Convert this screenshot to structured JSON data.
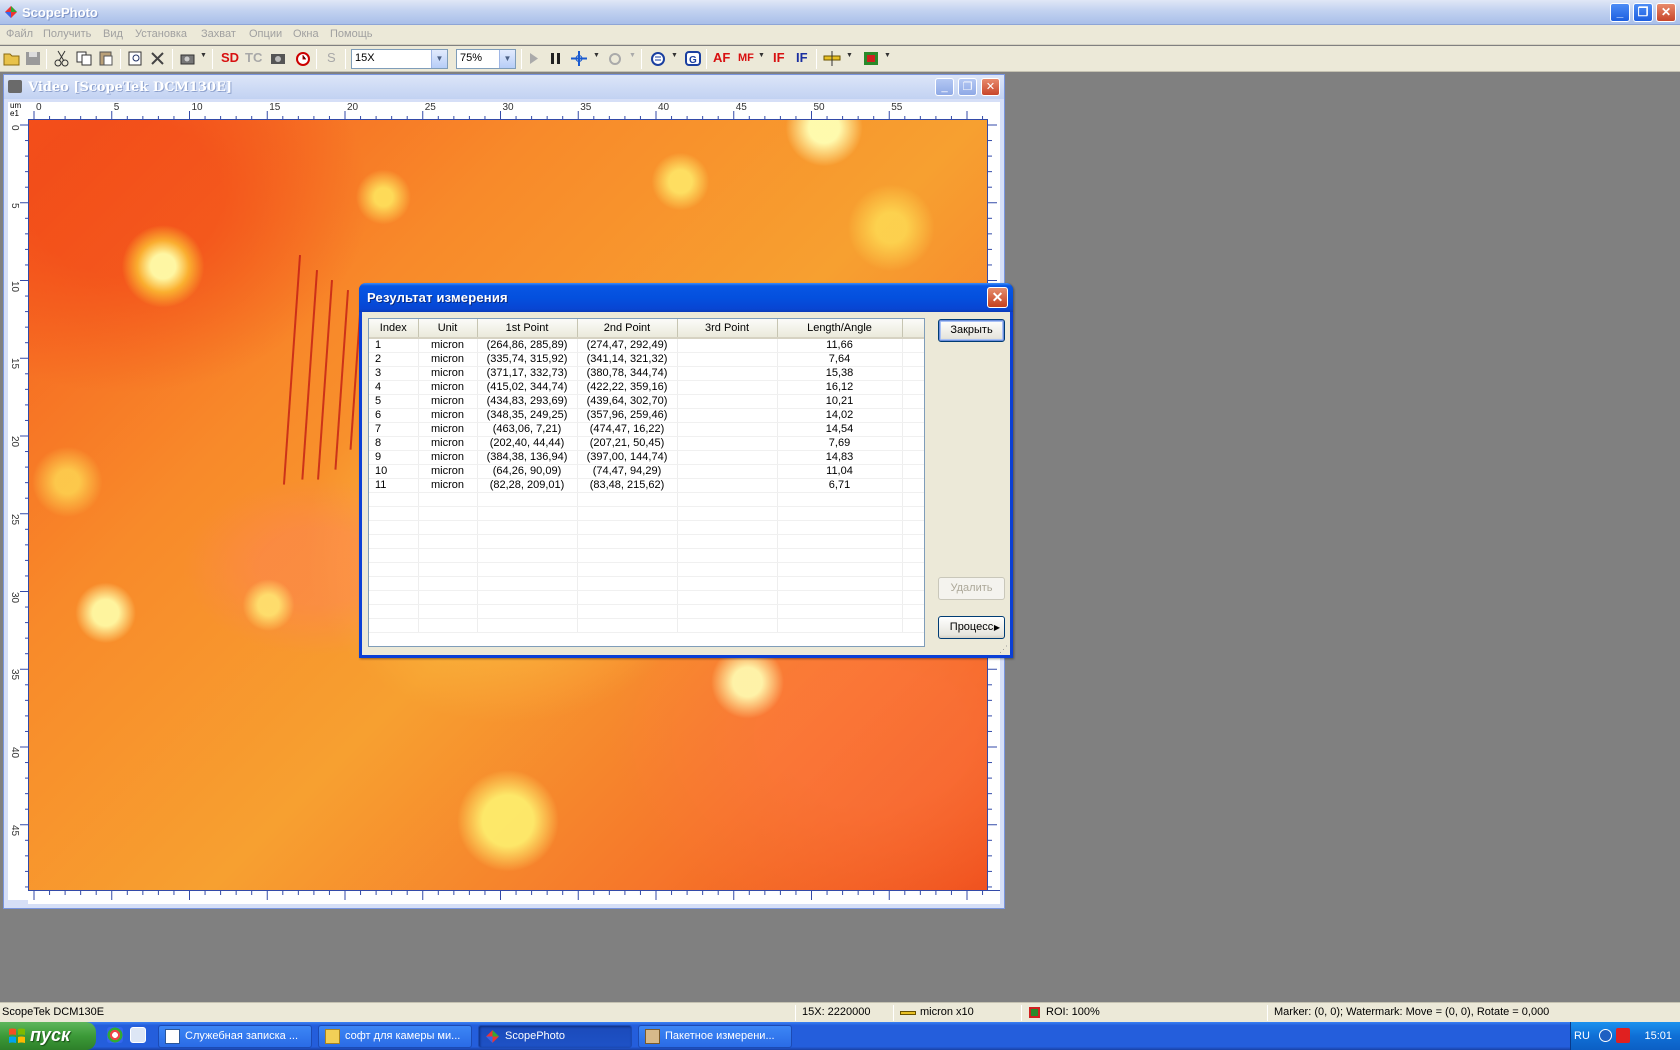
{
  "app": {
    "title": "ScopePhoto",
    "controls": {
      "minimize": "_",
      "restore": "❐",
      "close": "✕"
    }
  },
  "menu": [
    "Файл",
    "Получить",
    "Вид",
    "Установка",
    "Захват",
    "Опции",
    "Окна",
    "Помощь"
  ],
  "toolbar": {
    "sd_label": "SD",
    "tc_label": "TC",
    "s_label": "S",
    "zoom_combo": "15X",
    "scale_combo": "75%",
    "af_label": "AF",
    "mf_label": "MF",
    "if1_label": "IF",
    "if2_label": "IF"
  },
  "video_window": {
    "title": "Video [ScopeTek DCM130E]",
    "ruler_unit": "um e1",
    "ruler_top_labels": [
      "0",
      "5",
      "10",
      "15",
      "20",
      "25",
      "30",
      "35",
      "40",
      "45",
      "50",
      "55"
    ],
    "ruler_left_labels": [
      "0",
      "5",
      "10",
      "15",
      "20",
      "25",
      "30",
      "35",
      "40",
      "45"
    ]
  },
  "dialog": {
    "title": "Результат измерения",
    "columns": [
      "Index",
      "Unit",
      "1st Point",
      "2nd Point",
      "3rd Point",
      "Length/Angle"
    ],
    "rows": [
      [
        "1",
        "micron",
        "(264,86, 285,89)",
        "(274,47, 292,49)",
        "",
        "11,66"
      ],
      [
        "2",
        "micron",
        "(335,74, 315,92)",
        "(341,14, 321,32)",
        "",
        "7,64"
      ],
      [
        "3",
        "micron",
        "(371,17, 332,73)",
        "(380,78, 344,74)",
        "",
        "15,38"
      ],
      [
        "4",
        "micron",
        "(415,02, 344,74)",
        "(422,22, 359,16)",
        "",
        "16,12"
      ],
      [
        "5",
        "micron",
        "(434,83, 293,69)",
        "(439,64, 302,70)",
        "",
        "10,21"
      ],
      [
        "6",
        "micron",
        "(348,35, 249,25)",
        "(357,96, 259,46)",
        "",
        "14,02"
      ],
      [
        "7",
        "micron",
        "(463,06, 7,21)",
        "(474,47, 16,22)",
        "",
        "14,54"
      ],
      [
        "8",
        "micron",
        "(202,40, 44,44)",
        "(207,21, 50,45)",
        "",
        "7,69"
      ],
      [
        "9",
        "micron",
        "(384,38, 136,94)",
        "(397,00, 144,74)",
        "",
        "14,83"
      ],
      [
        "10",
        "micron",
        "(64,26, 90,09)",
        "(74,47, 94,29)",
        "",
        "11,04"
      ],
      [
        "11",
        "micron",
        "(82,28, 209,01)",
        "(83,48, 215,62)",
        "",
        "6,71"
      ]
    ],
    "empty_rows": 10,
    "close_button": "Закрыть",
    "delete_button": "Удалить",
    "process_button": "Процесс"
  },
  "statusbar": {
    "camera": "ScopeTek DCM130E",
    "magnification": "15X: 2220000",
    "unit": "micron x10",
    "roi": "ROI: 100%",
    "marker": "Marker: (0, 0); Watermark: Move = (0, 0), Rotate = 0,000"
  },
  "taskbar": {
    "start_label": "пуск",
    "tasks": [
      {
        "label": "Служебная записка ...",
        "active": false
      },
      {
        "label": "софт для камеры ми...",
        "active": false
      },
      {
        "label": "ScopePhoto",
        "active": true
      },
      {
        "label": "Пакетное измерени...",
        "active": false
      }
    ],
    "lang": "RU",
    "clock": "15:01"
  },
  "colors": {
    "xp_title_blue": "#0450de",
    "taskbar_blue": "#245edc",
    "start_green": "#3c9a38",
    "ruler_blue": "#334aa8",
    "image_orange": "#f7a030"
  }
}
